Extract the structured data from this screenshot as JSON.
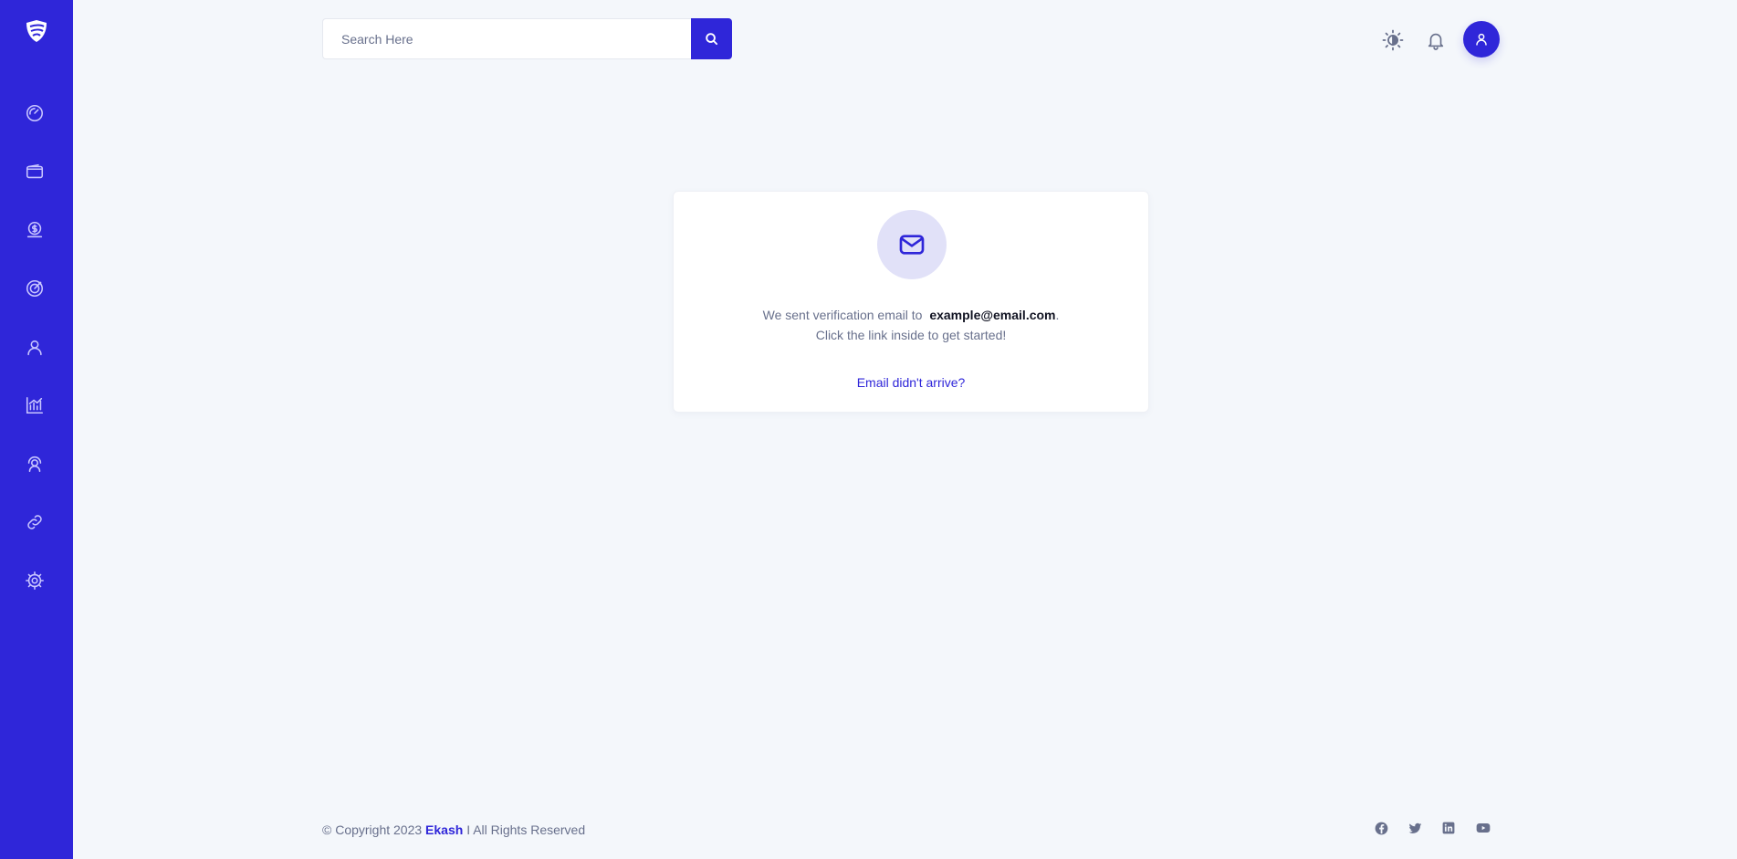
{
  "search": {
    "placeholder": "Search Here",
    "button_icon": "search-icon"
  },
  "sidebar": {
    "logo_icon": "shield-logo-icon",
    "items": [
      {
        "icon": "dashboard-gauge-icon"
      },
      {
        "icon": "wallet-icon"
      },
      {
        "icon": "money-bag-icon"
      },
      {
        "icon": "target-icon"
      },
      {
        "icon": "user-icon"
      },
      {
        "icon": "analytics-chart-icon"
      },
      {
        "icon": "support-icon"
      },
      {
        "icon": "link-icon"
      },
      {
        "icon": "settings-gear-icon"
      }
    ]
  },
  "header": {
    "theme_icon": "sun-icon",
    "notification_icon": "bell-icon",
    "profile_icon": "user-icon"
  },
  "verify": {
    "icon": "mail-icon",
    "line1_prefix": "We sent verification email to",
    "email": "example@email.com",
    "line1_suffix": ".",
    "line2": "Click the link inside to get started!",
    "resend_link": "Email didn't arrive?"
  },
  "footer": {
    "prefix": "© Copyright 2023",
    "brand": "Ekash",
    "suffix": "I All Rights Reserved",
    "social": [
      "facebook-icon",
      "twitter-icon",
      "linkedin-icon",
      "youtube-icon"
    ]
  },
  "colors": {
    "primary": "#2f26d9",
    "background": "#f4f7fb",
    "text_muted": "#68708c",
    "text_dark": "#111322",
    "icon_circle": "#e1e1f8"
  }
}
